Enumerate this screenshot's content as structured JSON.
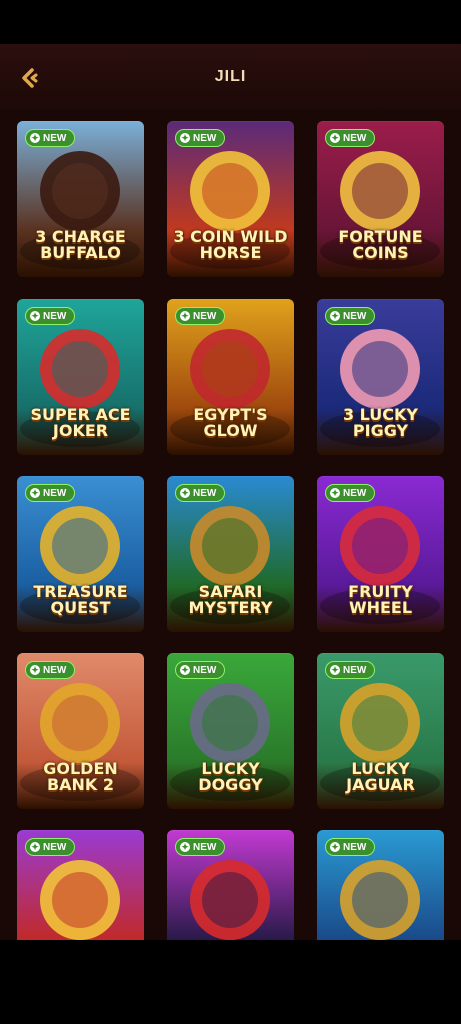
{
  "header": {
    "title": "JILI"
  },
  "badge_label": "NEW",
  "games": [
    {
      "name": "3 CHARGE BUFFALO",
      "colors": [
        "#7ab0d9",
        "#5a3220",
        "#3a1a10"
      ]
    },
    {
      "name": "3 COIN WILD HORSE",
      "colors": [
        "#5b2a7a",
        "#c03a1e",
        "#f2c33a"
      ]
    },
    {
      "name": "FORTUNE COINS",
      "colors": [
        "#9b1d4a",
        "#6a1538",
        "#f1c140"
      ]
    },
    {
      "name": "SUPER ACE JOKER",
      "colors": [
        "#1fa59a",
        "#17706b",
        "#d82b2b"
      ]
    },
    {
      "name": "EGYPT'S GLOW",
      "colors": [
        "#e0a21c",
        "#a04a0e",
        "#c1282e"
      ]
    },
    {
      "name": "3 LUCKY PIGGY",
      "colors": [
        "#3a3c9a",
        "#1b2a7a",
        "#f19bb2"
      ]
    },
    {
      "name": "TREASURE QUEST",
      "colors": [
        "#3a8fd2",
        "#1a5fa2",
        "#e6b22a"
      ]
    },
    {
      "name": "SAFARI MYSTERY",
      "colors": [
        "#2a8ad2",
        "#1f6a2a",
        "#c9892a"
      ]
    },
    {
      "name": "FRUITY WHEEL",
      "colors": [
        "#8a2ad2",
        "#5a1a9a",
        "#d82b3b"
      ]
    },
    {
      "name": "GOLDEN BANK 2",
      "colors": [
        "#e08a6a",
        "#c35a3a",
        "#e2a62a"
      ]
    },
    {
      "name": "LUCKY DOGGY",
      "colors": [
        "#3aa83a",
        "#2a7a2a",
        "#6a6a8a"
      ]
    },
    {
      "name": "LUCKY JAGUAR",
      "colors": [
        "#3a9a6a",
        "#2a7a4a",
        "#d8a22a"
      ]
    },
    {
      "name": "",
      "colors": [
        "#9a3ad2",
        "#c02a2a",
        "#f2c33a"
      ]
    },
    {
      "name": "",
      "colors": [
        "#c23ad2",
        "#2a1a4a",
        "#d82b2b"
      ]
    },
    {
      "name": "",
      "colors": [
        "#2a9ad2",
        "#1a4a8a",
        "#d8a22a"
      ]
    }
  ]
}
